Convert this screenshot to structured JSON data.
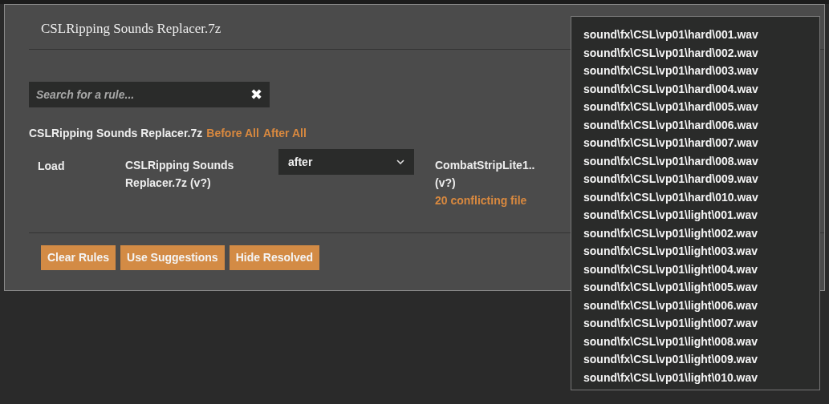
{
  "dialog": {
    "title": "CSLRipping Sounds Replacer.7z"
  },
  "search": {
    "placeholder": "Search for a rule...",
    "clear_icon": "✖"
  },
  "heading": {
    "name": "CSLRipping Sounds Replacer.7z",
    "links": [
      "Before All",
      "After All"
    ]
  },
  "rule": {
    "label": "Load",
    "mod": "CSLRipping Sounds Replacer.7z (v?)",
    "order": "after",
    "target": "CombatStripLite1..",
    "target_version": "(v?)",
    "conflicts": "20 conflicting file"
  },
  "buttons": [
    "Clear Rules",
    "Use Suggestions",
    "Hide Resolved"
  ],
  "tooltip": {
    "files": [
      "sound\\fx\\CSL\\vp01\\hard\\001.wav",
      "sound\\fx\\CSL\\vp01\\hard\\002.wav",
      "sound\\fx\\CSL\\vp01\\hard\\003.wav",
      "sound\\fx\\CSL\\vp01\\hard\\004.wav",
      "sound\\fx\\CSL\\vp01\\hard\\005.wav",
      "sound\\fx\\CSL\\vp01\\hard\\006.wav",
      "sound\\fx\\CSL\\vp01\\hard\\007.wav",
      "sound\\fx\\CSL\\vp01\\hard\\008.wav",
      "sound\\fx\\CSL\\vp01\\hard\\009.wav",
      "sound\\fx\\CSL\\vp01\\hard\\010.wav",
      "sound\\fx\\CSL\\vp01\\light\\001.wav",
      "sound\\fx\\CSL\\vp01\\light\\002.wav",
      "sound\\fx\\CSL\\vp01\\light\\003.wav",
      "sound\\fx\\CSL\\vp01\\light\\004.wav",
      "sound\\fx\\CSL\\vp01\\light\\005.wav",
      "sound\\fx\\CSL\\vp01\\light\\006.wav",
      "sound\\fx\\CSL\\vp01\\light\\007.wav",
      "sound\\fx\\CSL\\vp01\\light\\008.wav",
      "sound\\fx\\CSL\\vp01\\light\\009.wav",
      "sound\\fx\\CSL\\vp01\\light\\010.wav"
    ]
  }
}
